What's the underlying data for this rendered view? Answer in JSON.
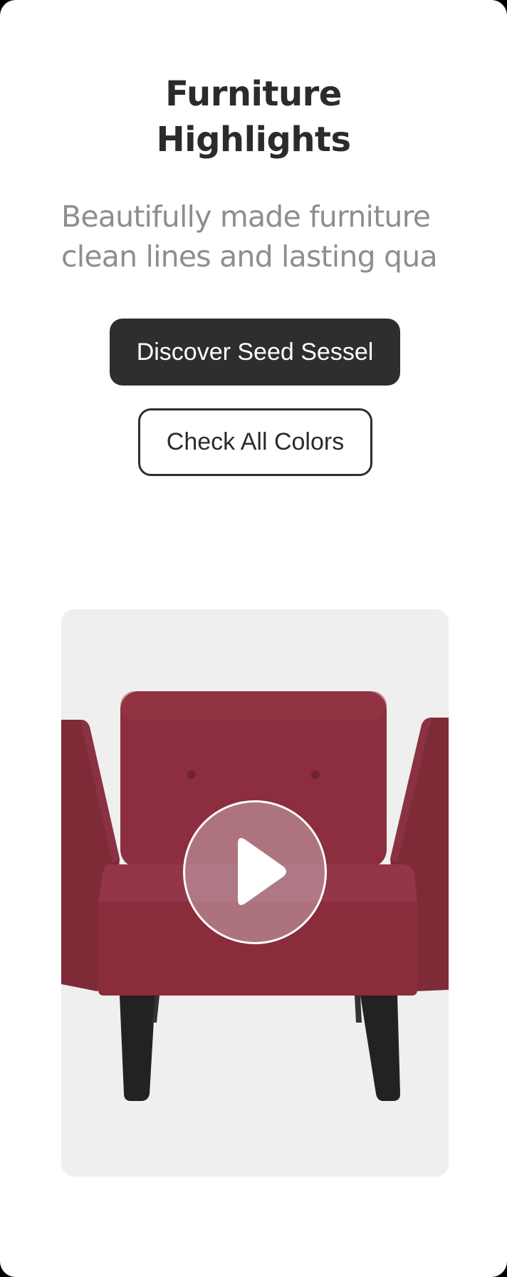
{
  "hero": {
    "title_line1": "Furniture",
    "title_line2": "Highlights",
    "subtitle_line1": "Beautifully made furniture",
    "subtitle_line2": "clean lines and lasting qua"
  },
  "actions": {
    "primary_label": "Discover Seed Sessel",
    "secondary_label": "Check All Colors"
  },
  "media": {
    "play_icon": "play-icon",
    "chair_color": "#8c2e3f",
    "background_color": "#efefef"
  }
}
